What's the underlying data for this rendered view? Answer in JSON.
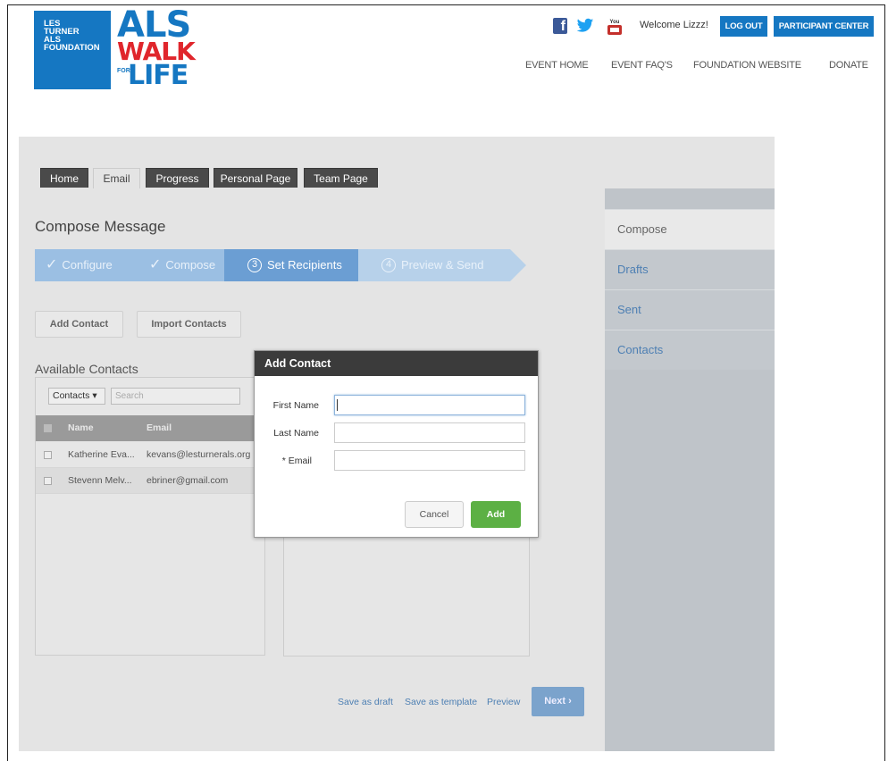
{
  "header": {
    "logo": {
      "org_lines": [
        "LES",
        "TURNER",
        "ALS",
        "FOUNDATION"
      ],
      "als": "ALS",
      "walk": "WALK",
      "for": "FOR",
      "life": "LIFE"
    },
    "social": {
      "facebook": "f",
      "twitter": "twitter-icon",
      "youtube": "youtube-icon"
    },
    "welcome": "Welcome Lizzz!",
    "logout_label": "LOG OUT",
    "participant_center_label": "PARTICIPANT CENTER",
    "nav": [
      "EVENT HOME",
      "EVENT FAQ'S",
      "FOUNDATION WEBSITE",
      "DONATE"
    ]
  },
  "tabs": [
    "Home",
    "Email",
    "Progress",
    "Personal Page",
    "Team Page"
  ],
  "main": {
    "title": "Compose Message",
    "steps": [
      {
        "label": "Configure",
        "state": "done"
      },
      {
        "label": "Compose",
        "state": "done"
      },
      {
        "num": "3",
        "label": "Set Recipients",
        "state": "active"
      },
      {
        "num": "4",
        "label": "Preview & Send",
        "state": "todo"
      }
    ],
    "add_contact_label": "Add Contact",
    "import_contacts_label": "Import Contacts",
    "available_contacts": "Available Contacts",
    "contacts_select": "Contacts ▾",
    "search_placeholder": "Search",
    "columns": {
      "name": "Name",
      "email": "Email"
    },
    "rows": [
      {
        "name": "Katherine Eva...",
        "email": "kevans@lesturnerals.org"
      },
      {
        "name": "Stevenn Melv...",
        "email": "ebriner@gmail.com"
      }
    ],
    "save_draft": "Save as draft",
    "save_template": "Save as template",
    "preview": "Preview",
    "next": "Next ›"
  },
  "sidebar": [
    "Compose",
    "Drafts",
    "Sent",
    "Contacts"
  ],
  "modal": {
    "title": "Add Contact",
    "first_name_label": "First Name",
    "last_name_label": "Last Name",
    "email_label": "* Email",
    "first_name_value": "",
    "last_name_value": "",
    "email_value": "",
    "cancel_label": "Cancel",
    "add_label": "Add"
  },
  "colors": {
    "brand_blue": "#1577c2",
    "brand_red": "#e0262c",
    "add_green": "#5cb044"
  }
}
